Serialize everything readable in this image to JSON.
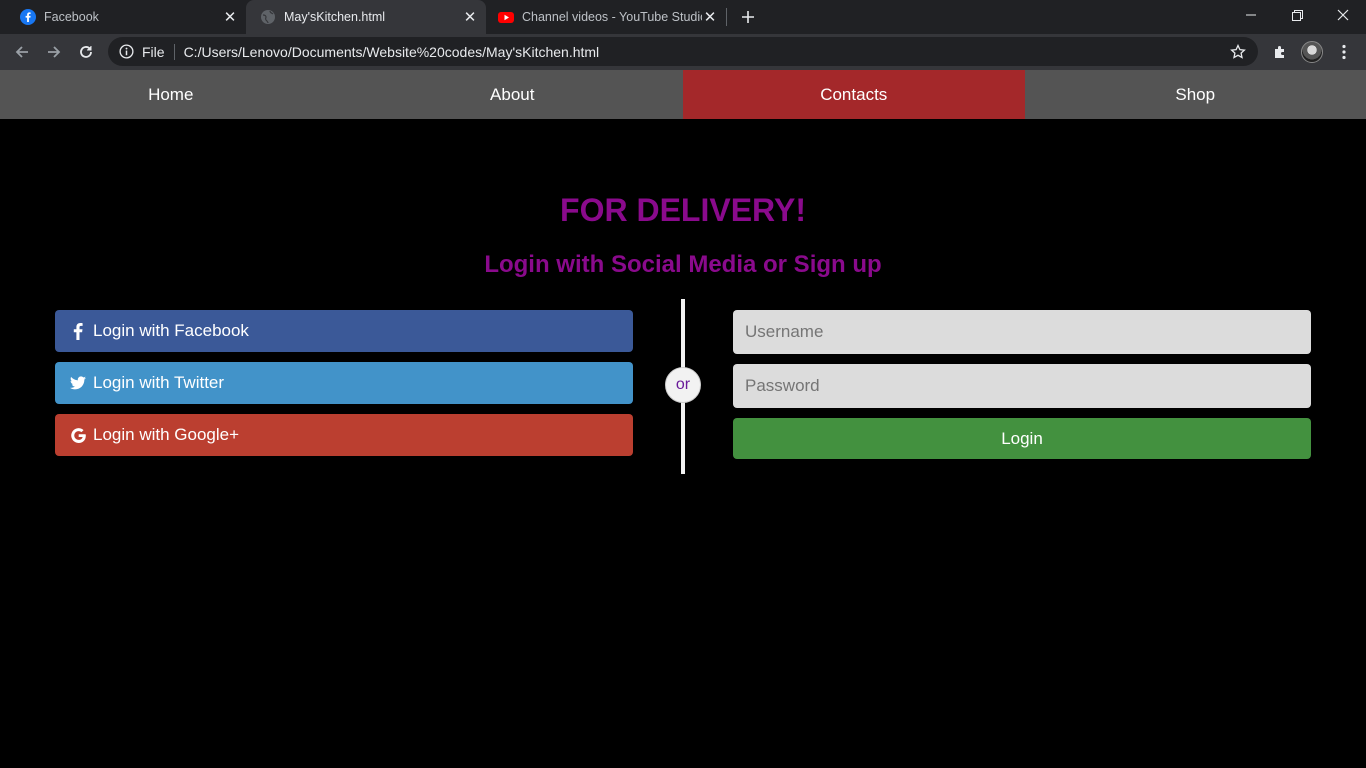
{
  "browser": {
    "tabs": [
      {
        "title": "Facebook",
        "icon": "facebook-icon"
      },
      {
        "title": "May'sKitchen.html",
        "icon": "globe-icon"
      },
      {
        "title": "Channel videos - YouTube Studio",
        "icon": "youtube-icon"
      }
    ],
    "address": {
      "scheme_label": "File",
      "url": "C:/Users/Lenovo/Documents/Website%20codes/May'sKitchen.html"
    }
  },
  "nav": {
    "items": [
      "Home",
      "About",
      "Contacts",
      "Shop"
    ],
    "active": "Contacts"
  },
  "main": {
    "title": "FOR DELIVERY!",
    "subtitle": "Login with Social Media or Sign up",
    "social": {
      "facebook": "Login with Facebook",
      "twitter": "Login with Twitter",
      "google": "Login with Google+"
    },
    "divider": "or",
    "form": {
      "username_placeholder": "Username",
      "password_placeholder": "Password",
      "login_label": "Login"
    }
  },
  "colors": {
    "accent_purple": "#8a0a8c",
    "nav_active": "#a4282a",
    "facebook": "#3b5998",
    "twitter": "#4293c9",
    "google": "#bb3f30",
    "login": "#43913f"
  }
}
